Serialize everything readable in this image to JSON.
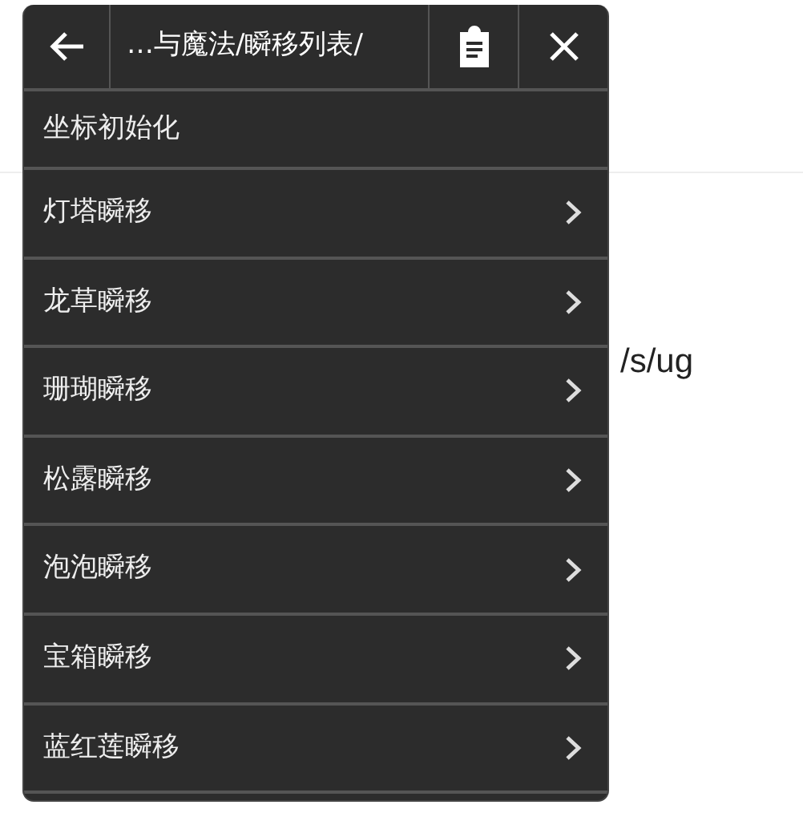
{
  "background": {
    "text": "/s/ug"
  },
  "menu": {
    "title": "…与魔法/瞬移列表/",
    "items": [
      {
        "label": "坐标初始化",
        "kind": "action"
      },
      {
        "label": "灯塔瞬移",
        "kind": "submenu"
      },
      {
        "label": "龙草瞬移",
        "kind": "submenu"
      },
      {
        "label": "珊瑚瞬移",
        "kind": "submenu"
      },
      {
        "label": "松露瞬移",
        "kind": "submenu"
      },
      {
        "label": "泡泡瞬移",
        "kind": "submenu"
      },
      {
        "label": "宝箱瞬移",
        "kind": "submenu"
      },
      {
        "label": "蓝红莲瞬移",
        "kind": "submenu"
      }
    ]
  }
}
